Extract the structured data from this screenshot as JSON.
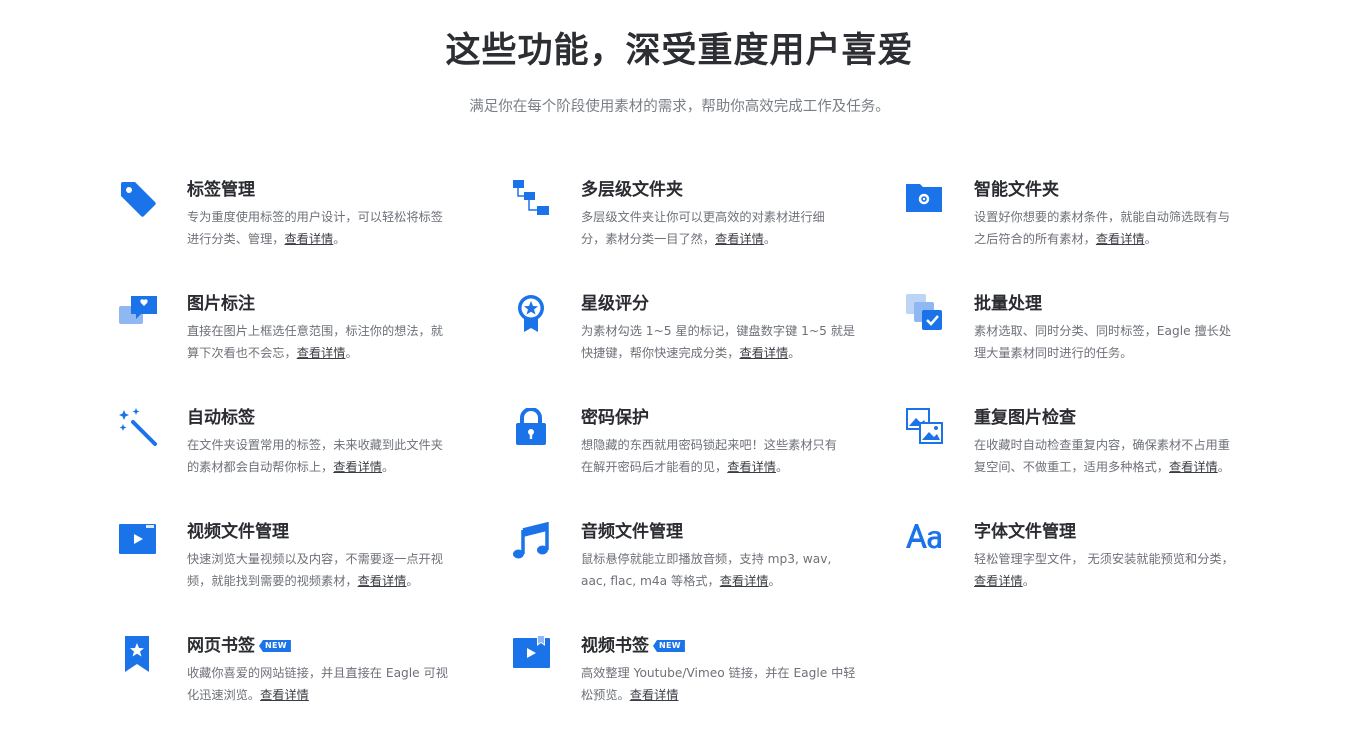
{
  "header": {
    "title": "这些功能，深受重度用户喜爱",
    "subtitle": "满足你在每个阶段使用素材的需求，帮助你高效完成工作及任务。"
  },
  "colors": {
    "accent": "#1a73e8",
    "accent_light": "#8fb8f2"
  },
  "features": [
    {
      "icon": "tag-icon",
      "title": "标签管理",
      "desc_line1": "专为重度使用标签的用户设计，可以轻松将标签",
      "desc_line2": "进行分类、管理，",
      "link": "查看详情",
      "suffix": "。"
    },
    {
      "icon": "folder-tree-icon",
      "title": "多层级文件夹",
      "desc_line1": "多层级文件夹让你可以更高效的对素材进行细",
      "desc_line2": "分，素材分类一目了然，",
      "link": "查看详情",
      "suffix": "。"
    },
    {
      "icon": "smart-folder-icon",
      "title": "智能文件夹",
      "desc_line1": "设置好你想要的素材条件，就能自动筛选既有与",
      "desc_line2": "之后符合的所有素材，",
      "link": "查看详情",
      "suffix": "。"
    },
    {
      "icon": "image-annotation-icon",
      "title": "图片标注",
      "desc_line1": "直接在图片上框选任意范围，标注你的想法，就",
      "desc_line2": "算下次看也不会忘，",
      "link": "查看详情",
      "suffix": "。"
    },
    {
      "icon": "star-badge-icon",
      "title": "星级评分",
      "desc_line1": "为素材勾选 1~5 星的标记，键盘数字键 1~5 就是",
      "desc_line2": "快捷键，帮你快速完成分类，",
      "link": "查看详情",
      "suffix": "。"
    },
    {
      "icon": "batch-process-icon",
      "title": "批量处理",
      "desc_line1": "素材选取、同时分类、同时标签，Eagle 擅长处",
      "desc_line2": "理大量素材同时进行的任务。",
      "link": "",
      "suffix": ""
    },
    {
      "icon": "magic-wand-icon",
      "title": "自动标签",
      "desc_line1": "在文件夹设置常用的标签，未来收藏到此文件夹",
      "desc_line2": "的素材都会自动帮你标上，",
      "link": "查看详情",
      "suffix": "。"
    },
    {
      "icon": "lock-icon",
      "title": "密码保护",
      "desc_line1": "想隐藏的东西就用密码锁起来吧！这些素材只有",
      "desc_line2": "在解开密码后才能看的见，",
      "link": "查看详情",
      "suffix": "。"
    },
    {
      "icon": "duplicate-images-icon",
      "title": "重复图片检查",
      "desc_line1": "在收藏时自动检查重复内容，确保素材不占用重",
      "desc_line2": "复空间、不做重工，适用多种格式，",
      "link": "查看详情",
      "suffix": "。"
    },
    {
      "icon": "video-file-icon",
      "title": "视频文件管理",
      "desc_line1": "快速浏览大量视频以及内容，不需要逐一点开视",
      "desc_line2": "频，就能找到需要的视频素材，",
      "link": "查看详情",
      "suffix": "。"
    },
    {
      "icon": "music-note-icon",
      "title": "音频文件管理",
      "desc_line1": "鼠标悬停就能立即播放音频，支持 mp3, wav,",
      "desc_line2": "aac, flac, m4a 等格式，",
      "link": "查看详情",
      "suffix": "。"
    },
    {
      "icon": "font-icon",
      "title": "字体文件管理",
      "desc_line1": "轻松管理字型文件， 无须安装就能预览和分类，",
      "desc_line2": "",
      "link": "查看详情",
      "suffix": "。"
    },
    {
      "icon": "bookmark-icon",
      "title": "网页书签",
      "badge": "NEW",
      "desc_line1": "收藏你喜爱的网站链接，并且直接在 Eagle 可视",
      "desc_line2": "化迅速浏览。",
      "link": "查看详情",
      "suffix": ""
    },
    {
      "icon": "video-bookmark-icon",
      "title": "视频书签",
      "badge": "NEW",
      "desc_line1": "高效整理 Youtube/Vimeo 链接，并在 Eagle 中轻",
      "desc_line2": "松预览。",
      "link": "查看详情",
      "suffix": ""
    }
  ]
}
